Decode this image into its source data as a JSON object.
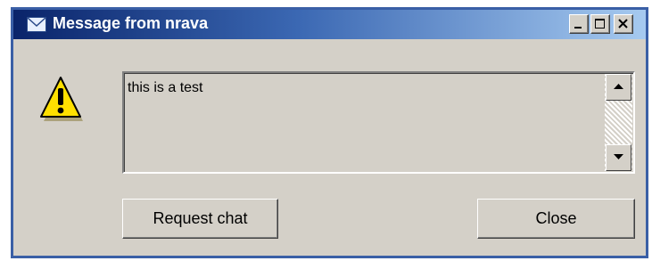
{
  "window": {
    "title": "Message from nrava",
    "title_icon": "envelope-icon",
    "caption_buttons": [
      "minimize-icon",
      "maximize-icon",
      "close-icon"
    ]
  },
  "message": {
    "icon": "warning-icon",
    "text": "this is a test"
  },
  "buttons": {
    "request_chat": "Request chat",
    "close": "Close"
  },
  "colors": {
    "titlebar_start": "#0a246a",
    "titlebar_end": "#a6caf0",
    "dialog_face": "#d4d0c8",
    "warning_yellow": "#ffe000"
  }
}
